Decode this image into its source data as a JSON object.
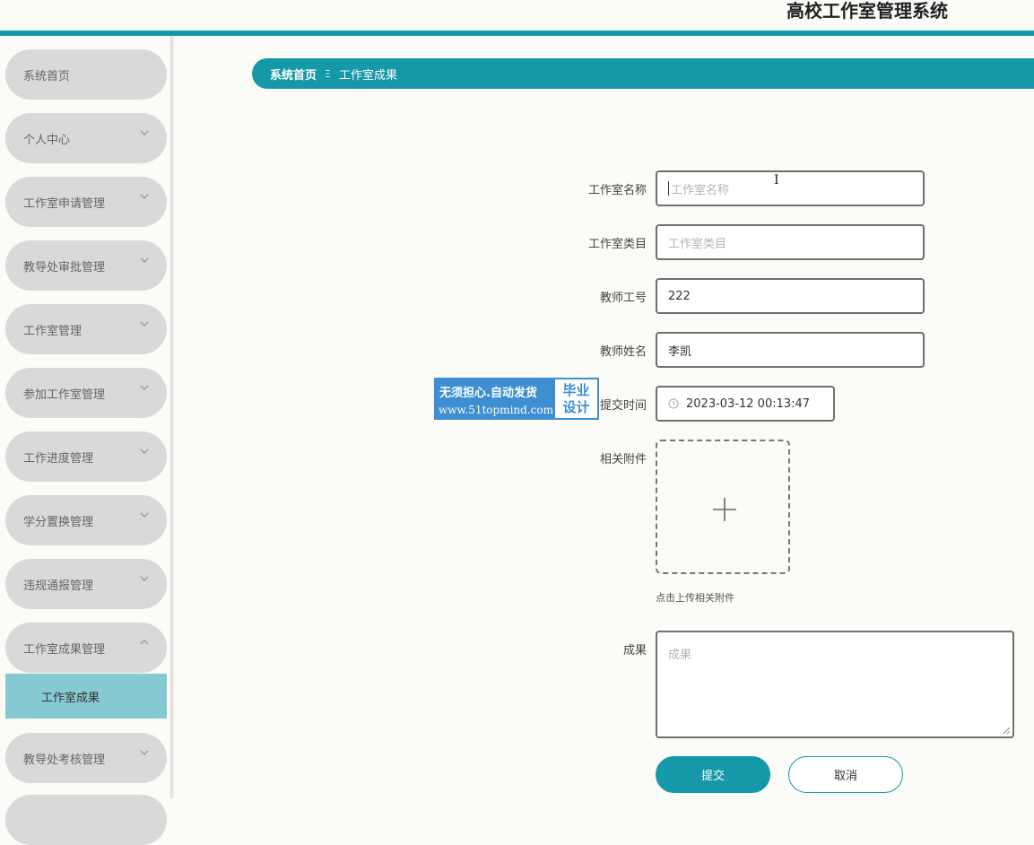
{
  "header": {
    "app_title": "高校工作室管理系统"
  },
  "sidebar": {
    "items": [
      {
        "label": "系统首页"
      },
      {
        "label": "个人中心"
      },
      {
        "label": "工作室申请管理"
      },
      {
        "label": "教导处审批管理"
      },
      {
        "label": "工作室管理"
      },
      {
        "label": "参加工作室管理"
      },
      {
        "label": "工作进度管理"
      },
      {
        "label": "学分置换管理"
      },
      {
        "label": "违规通报管理"
      },
      {
        "label": "工作室成果管理"
      },
      {
        "label": "教导处考核管理"
      }
    ],
    "active_sub_item": "工作室成果"
  },
  "breadcrumb": {
    "home": "系统首页",
    "separator": "Ξ",
    "current": "工作室成果"
  },
  "form": {
    "studio_name": {
      "label": "工作室名称",
      "placeholder": "工作室名称",
      "value": ""
    },
    "studio_category": {
      "label": "工作室类目",
      "placeholder": "工作室类目",
      "value": ""
    },
    "teacher_id": {
      "label": "教师工号",
      "value": "222"
    },
    "teacher_name": {
      "label": "教师姓名",
      "value": "李凯"
    },
    "submit_time": {
      "label": "提交时间",
      "value": "2023-03-12 00:13:47",
      "icon": "clock-icon"
    },
    "attachment": {
      "label": "相关附件",
      "hint": "点击上传相关附件",
      "icon": "plus-icon"
    },
    "achievement": {
      "label": "成果",
      "placeholder": "成果"
    },
    "submit_label": "提交",
    "cancel_label": "取消"
  },
  "watermark": {
    "line1": "无须担心.自动发货",
    "line2": "www.51topmind.com",
    "badge_line1": "毕业",
    "badge_line2": "设计"
  },
  "colors": {
    "accent": "#1598a8",
    "sidebar_item": "#d9d9d9",
    "active_sub": "#86c9d1",
    "watermark": "#3d8fd1"
  }
}
